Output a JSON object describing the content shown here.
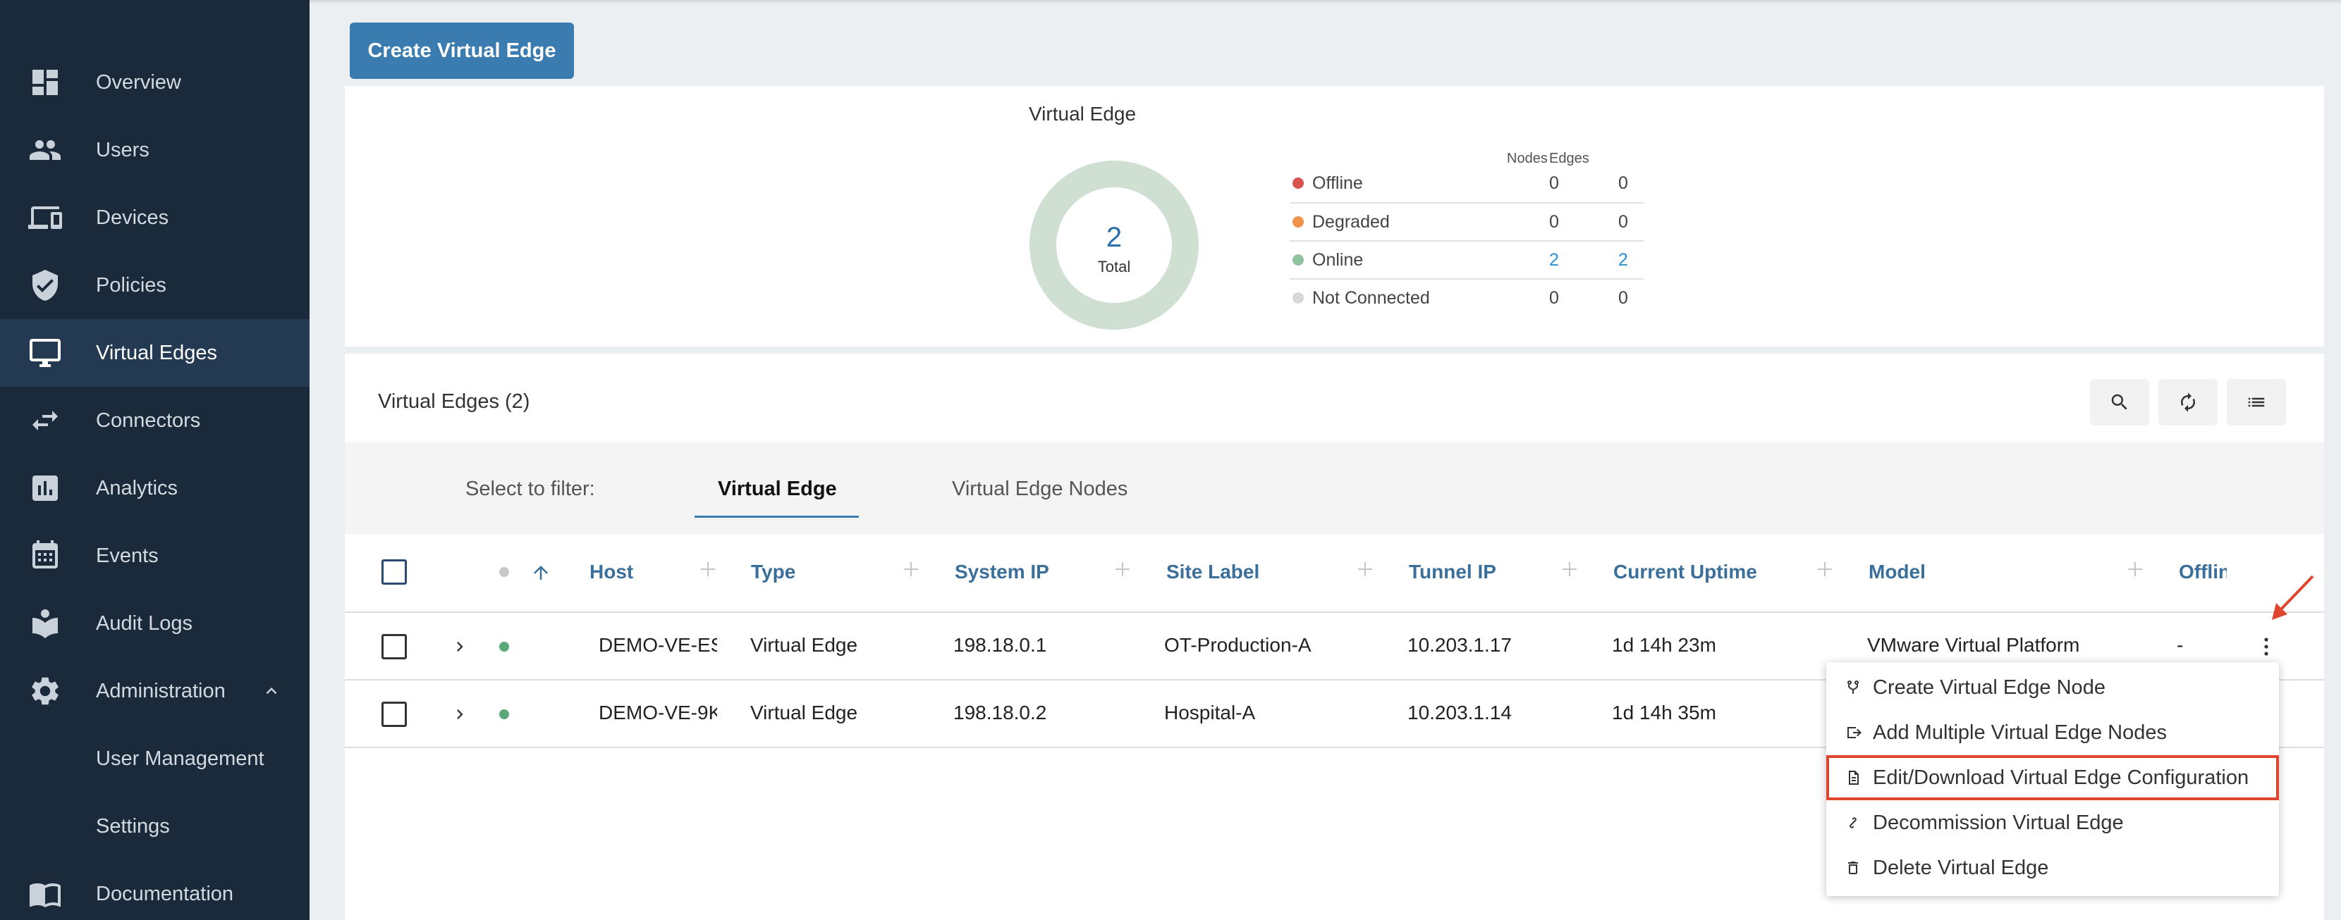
{
  "sidebar": {
    "items": [
      {
        "label": "Overview",
        "icon": "dashboard-icon"
      },
      {
        "label": "Users",
        "icon": "users-icon"
      },
      {
        "label": "Devices",
        "icon": "devices-icon"
      },
      {
        "label": "Policies",
        "icon": "shield-icon"
      },
      {
        "label": "Virtual Edges",
        "icon": "monitor-icon",
        "active": true
      },
      {
        "label": "Connectors",
        "icon": "swap-arrows-icon"
      },
      {
        "label": "Analytics",
        "icon": "bar-chart-icon"
      },
      {
        "label": "Events",
        "icon": "calendar-icon"
      },
      {
        "label": "Audit Logs",
        "icon": "audit-log-icon"
      },
      {
        "label": "Administration",
        "icon": "gear-icon",
        "expanded": true
      },
      {
        "label": "User Management"
      },
      {
        "label": "Settings"
      },
      {
        "label": "Documentation",
        "icon": "book-icon"
      }
    ]
  },
  "toolbar": {
    "create_label": "Create Virtual Edge"
  },
  "summary": {
    "title": "Virtual Edge",
    "total_value": "2",
    "total_label": "Total",
    "nodes_header": "Nodes",
    "edges_header": "Edges",
    "rows": [
      {
        "name": "Offline",
        "nodes": "0",
        "edges": "0",
        "color": "#d9534f"
      },
      {
        "name": "Degraded",
        "nodes": "0",
        "edges": "0",
        "color": "#f0924a"
      },
      {
        "name": "Online",
        "nodes": "2",
        "edges": "2",
        "color": "#8fc3a0"
      },
      {
        "name": "Not Connected",
        "nodes": "0",
        "edges": "0",
        "color": "#d8d8d8"
      }
    ],
    "donut_color": "#cfe0d3"
  },
  "table": {
    "title": "Virtual Edges (2)",
    "filter_label": "Select to filter:",
    "filter_tabs": [
      "Virtual Edge",
      "Virtual Edge Nodes"
    ],
    "columns": [
      "Host",
      "Type",
      "System IP",
      "Site Label",
      "Tunnel IP",
      "Current Uptime",
      "Model",
      "Offlin"
    ],
    "rows": [
      {
        "host": "DEMO-VE-ES",
        "type": "Virtual Edge",
        "system_ip": "198.18.0.1",
        "site_label": "OT-Production-A",
        "tunnel_ip": "10.203.1.17",
        "uptime": "1d 14h 23m",
        "model": "VMware Virtual Platform",
        "offline": "-"
      },
      {
        "host": "DEMO-VE-9K",
        "type": "Virtual Edge",
        "system_ip": "198.18.0.2",
        "site_label": "Hospital-A",
        "tunnel_ip": "10.203.1.14",
        "uptime": "1d 14h 35m",
        "model": "",
        "offline": ""
      }
    ]
  },
  "menu": {
    "items": [
      {
        "label": "Create Virtual Edge Node",
        "icon": "fork-icon"
      },
      {
        "label": "Add Multiple Virtual Edge Nodes",
        "icon": "add-multiple-icon"
      },
      {
        "label": "Edit/Download Virtual Edge Configuration",
        "icon": "config-file-icon"
      },
      {
        "label": "Decommission Virtual Edge",
        "icon": "unlink-icon"
      },
      {
        "label": "Delete Virtual Edge",
        "icon": "trash-icon"
      }
    ]
  },
  "colors": {
    "accent": "#3a7bb0",
    "highlight": "#e0452f",
    "sidebar": "#1b2a3a"
  }
}
